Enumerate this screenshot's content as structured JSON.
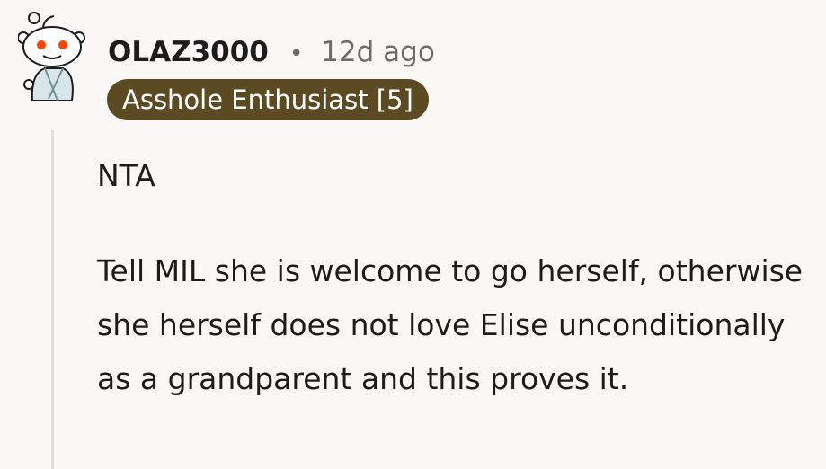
{
  "comment": {
    "author": "OLAZ3000",
    "separator": "•",
    "timestamp": "12d ago",
    "flair": "Asshole Enthusiast [5]",
    "paragraphs": [
      "NTA",
      "Tell MIL she is welcome to go herself, otherwise she herself does not love Elise unconditionally as a grandparent and this proves it."
    ],
    "avatar_icon": "snoo-avatar-icon"
  }
}
